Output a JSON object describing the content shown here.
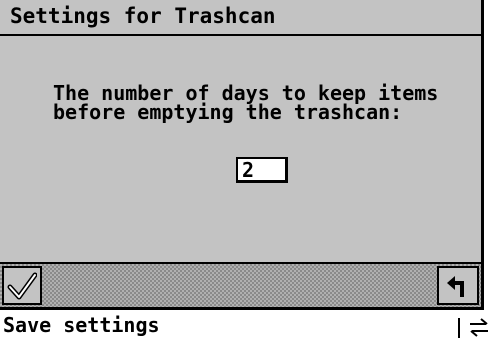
{
  "dialog": {
    "title": "Settings for Trashcan",
    "message_line1": "The number of days to keep items",
    "message_line2": "before emptying the trashcan:",
    "days_value": "2"
  },
  "toolbar": {
    "ok_icon": "checkmark-icon",
    "back_icon": "return-arrow-icon"
  },
  "status": {
    "text": "Save settings",
    "switch_icon": "switch-arrows-icon"
  },
  "colors": {
    "dialog_background": "#c3c3c3",
    "text": "#000000",
    "input_background": "#ffffff"
  }
}
